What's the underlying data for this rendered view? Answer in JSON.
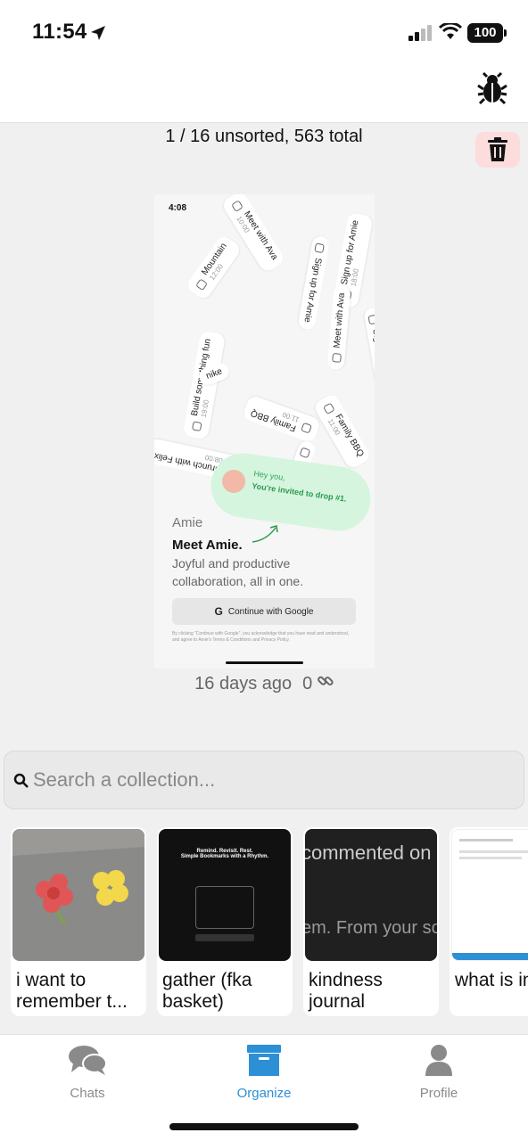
{
  "status_bar": {
    "time": "11:54",
    "battery": "100"
  },
  "counter": {
    "text": "1 / 16 unsorted, 563 total"
  },
  "preview": {
    "time": "4:08",
    "chips": [
      {
        "label": "Meet with Ava",
        "sub": "10:00"
      },
      {
        "label": "Mountain",
        "sub": "12:00"
      },
      {
        "label": "Sign up for Amie",
        "sub": "18:00"
      },
      {
        "label": "Build something fun",
        "sub": "19:00"
      },
      {
        "label": "nike",
        "sub": ""
      },
      {
        "label": "Family BBQ",
        "sub": "11:00"
      },
      {
        "label": "Brunch with Felix",
        "sub": "08:00"
      }
    ],
    "invite": {
      "line1": "Hey you,",
      "line2": "You're invited to drop #1."
    },
    "brand": "Amie",
    "headline": "Meet Amie.",
    "subhead": "Joyful and productive collaboration, all in one.",
    "google_button": "Continue with Google",
    "legal": "By clicking \"Continue with Google\", you acknowledge that you have read and understood, and agree to Amie's Terms & Conditions and Privacy Policy."
  },
  "item_meta": {
    "age": "16 days ago",
    "links": "0"
  },
  "search": {
    "placeholder": "Search a collection..."
  },
  "collections": [
    {
      "label": "i want to remember t...",
      "thumb": "sidewalk flowers"
    },
    {
      "label": "gather (fka basket)",
      "thumb_title": "Remind. Revisit. Rest.",
      "thumb_sub": "Simple Bookmarks with a Rhythm."
    },
    {
      "label": "kindness journal",
      "thumb_text1": "commented on",
      "thumb_text2": "em. From your sc"
    },
    {
      "label": "what is internet",
      "thumb": "document screenshot"
    }
  ],
  "tabs": [
    {
      "label": "Chats",
      "icon": "chat-bubbles-icon",
      "active": false
    },
    {
      "label": "Organize",
      "icon": "archive-box-icon",
      "active": true
    },
    {
      "label": "Profile",
      "icon": "person-icon",
      "active": false
    }
  ],
  "colors": {
    "accent": "#2d8fd6",
    "tab_inactive": "#8a8a8a",
    "trash_bg": "#fcdcdc"
  }
}
